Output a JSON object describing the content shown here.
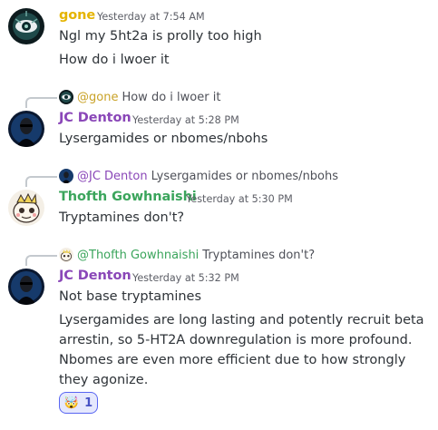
{
  "messages": [
    {
      "author": "gone",
      "author_color": "#e5b400",
      "timestamp": "Yesterday at 7:54 AM",
      "lines": [
        "Ngl my 5ht2a is prolly too high",
        "How do i lwoer it"
      ]
    },
    {
      "reply": {
        "mention": "@gone",
        "preview": "How do i lwoer it"
      },
      "author": "JC Denton",
      "author_color": "#8a47b8",
      "timestamp": "Yesterday at 5:28 PM",
      "lines": [
        "Lysergamides or nbomes/nbohs"
      ]
    },
    {
      "reply": {
        "mention": "@JC Denton",
        "preview": "Lysergamides or nbomes/nbohs"
      },
      "author": "Thofth Gowhnaishi",
      "author_color": "#3ba55c",
      "timestamp": "Yesterday at 5:30 PM",
      "lines": [
        "Tryptamines don't?"
      ]
    },
    {
      "reply": {
        "mention": "@Thofth Gowhnaishi",
        "preview": "Tryptamines don't?"
      },
      "author": "JC Denton",
      "author_color": "#8a47b8",
      "timestamp": "Yesterday at 5:32 PM",
      "lines": [
        "Not base tryptamines",
        "Lysergamides are long lasting and potently recruit beta arrestin, so 5-HT2A downregulation is more profound. Nbomes are even more efficient due to how strongly they agonize."
      ],
      "reaction": {
        "emoji": "🤯",
        "count": "1"
      }
    }
  ],
  "colors": {
    "mention_purple": "#8a47b8",
    "mention_gold": "#c9a227",
    "mention_green": "#3ba55c",
    "reaction_border": "#5865f2"
  }
}
